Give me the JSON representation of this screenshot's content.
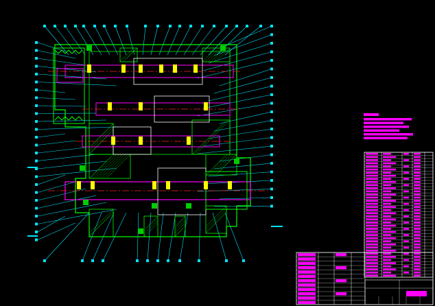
{
  "drawing": {
    "background": "#000000",
    "colors": {
      "outline": "#ffffff",
      "casing": "#00ff00",
      "hatch": "#00cc00",
      "shaft": "#ff00ff",
      "center_line": "#ff2020",
      "leader": "#00e5ff",
      "bearing": "#ffff00",
      "table_line": "#ffffff",
      "note_fill": "#ff00ff"
    },
    "balloon_count_top": 20,
    "balloon_count_left": 26,
    "balloon_count_right": 22,
    "balloon_count_bottom": 12
  },
  "notes": {
    "title": "",
    "lines": 6
  },
  "parts_list": {
    "rows": 40,
    "columns": 5
  },
  "title_block": {
    "rows": 12,
    "columns": 6
  }
}
